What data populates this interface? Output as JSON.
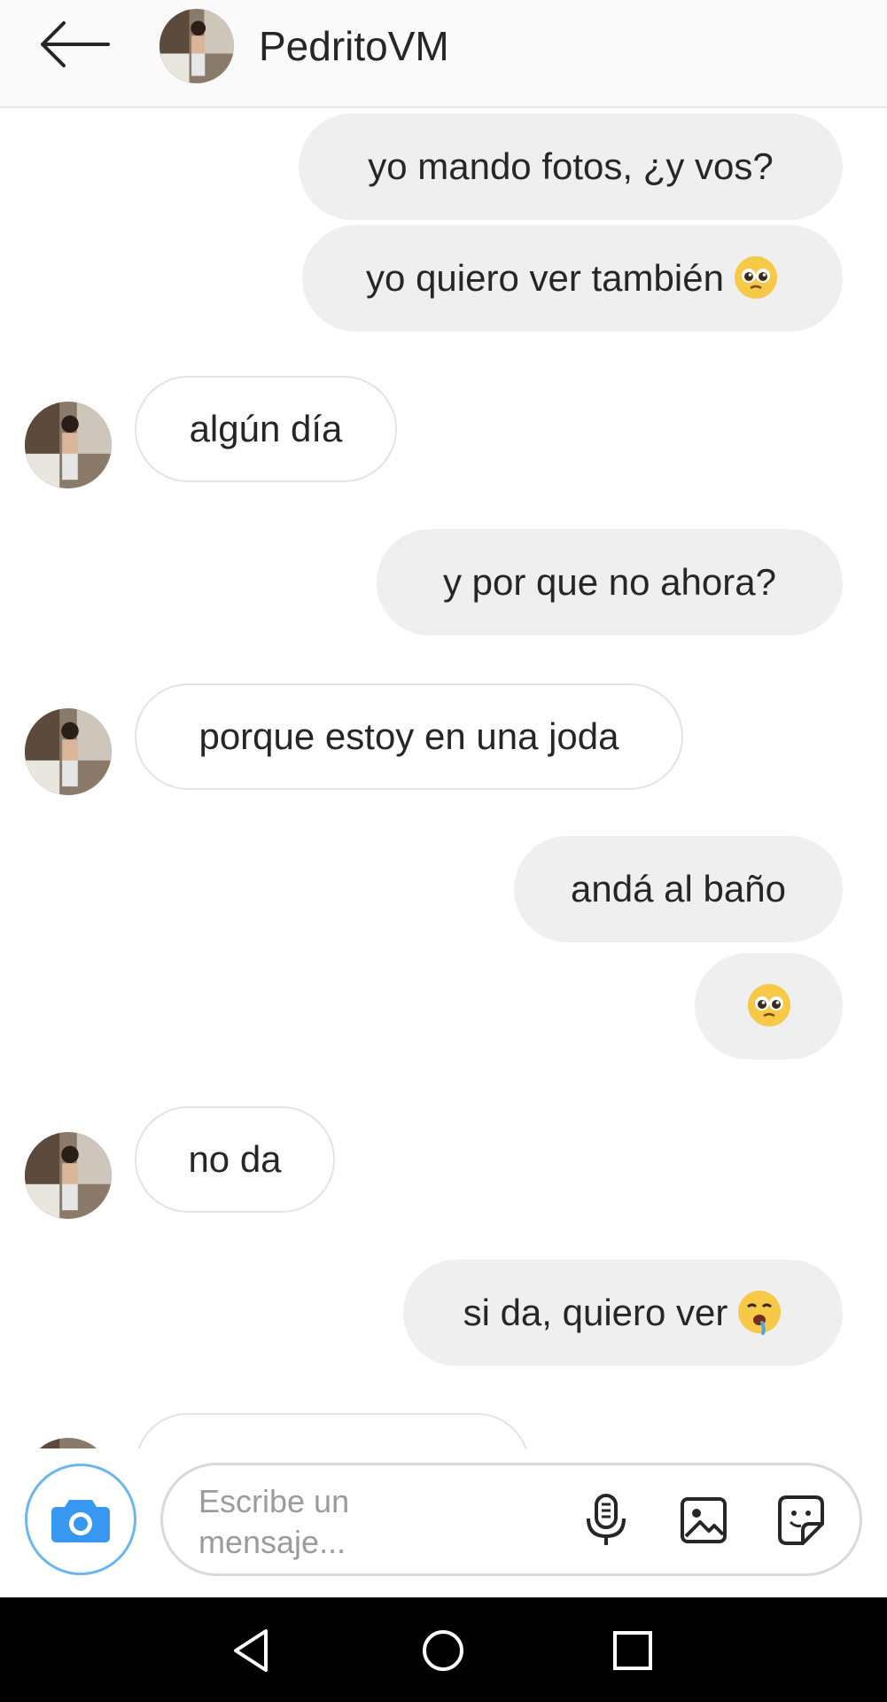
{
  "header": {
    "back_icon": "arrow-left-icon",
    "contact_name": "PedritoVM"
  },
  "messages": [
    {
      "direction": "outgoing",
      "text": "yo mando fotos, ¿y vos?"
    },
    {
      "direction": "outgoing",
      "text": "yo quiero ver también",
      "emoji": "pleading-face"
    },
    {
      "direction": "incoming",
      "text": "algún día"
    },
    {
      "direction": "outgoing",
      "text": "y por que no ahora?"
    },
    {
      "direction": "incoming",
      "text": "porque estoy en una joda"
    },
    {
      "direction": "outgoing",
      "text": "andá al baño"
    },
    {
      "direction": "outgoing",
      "text": "",
      "emoji": "pleading-face"
    },
    {
      "direction": "incoming",
      "text": "no da"
    },
    {
      "direction": "outgoing",
      "text": "si da, quiero ver",
      "emoji": "drooling-face"
    }
  ],
  "composer": {
    "placeholder": "Escribe un mensaje...",
    "camera_icon": "camera-icon",
    "mic_icon": "microphone-icon",
    "gallery_icon": "image-icon",
    "sticker_icon": "sticker-icon"
  },
  "navbar": {
    "back_icon": "triangle-back-icon",
    "home_icon": "circle-home-icon",
    "recents_icon": "square-recents-icon"
  },
  "colors": {
    "outgoing_bubble": "#efefef",
    "incoming_border": "#e3e3e3",
    "camera_accent": "#3897f0"
  }
}
